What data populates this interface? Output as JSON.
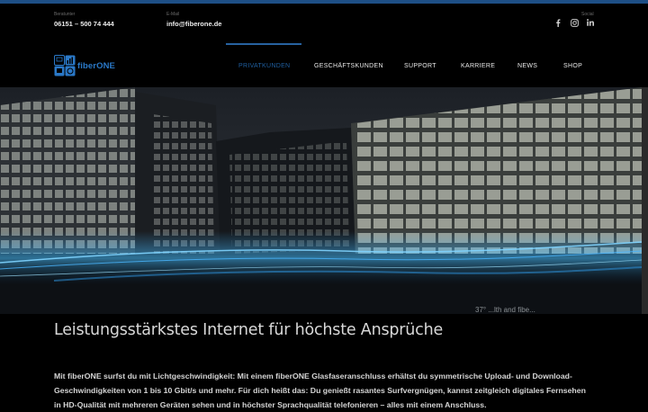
{
  "topbar": {
    "phone_label": "Beratunter",
    "phone": "06151 – 500 74 444",
    "email_label": "E-Mail",
    "email": "info@fiberone.de",
    "social_label": "Social",
    "social_icons": [
      "facebook-icon",
      "instagram-icon",
      "linkedin-icon"
    ]
  },
  "brand": {
    "name": "fiberONE",
    "color": "#2a78c7"
  },
  "nav": {
    "items": [
      {
        "label": "PRIVATKUNDEN",
        "active": true
      },
      {
        "label": "GESCHÄFTSKUNDEN",
        "active": false
      },
      {
        "label": "SUPPORT",
        "active": false
      },
      {
        "label": "KARRIERE",
        "active": false
      },
      {
        "label": "NEWS",
        "active": false
      },
      {
        "label": "SHOP",
        "active": false
      }
    ],
    "accent": "#1f5fa0"
  },
  "hero": {
    "caption": "37° ...lth and fibe..."
  },
  "main": {
    "headline": "Leistungsstärkstes Internet für höchste Ansprüche",
    "paragraph": "Mit fiberONE surfst du mit Lichtgeschwindigkeit: Mit einem fiberONE Glasfaseranschluss erhältst du symmetrische Upload- und Download-Geschwindigkeiten von 1 bis 10 Gbit/s und mehr. Für dich heißt das: Du genießt rasantes Surfvergnügen, kannst zeitgleich digitales Fernsehen in HD-Qualität mit mehreren Geräten sehen und in höchster Sprachqualität telefonieren – alles mit einem Anschluss."
  }
}
